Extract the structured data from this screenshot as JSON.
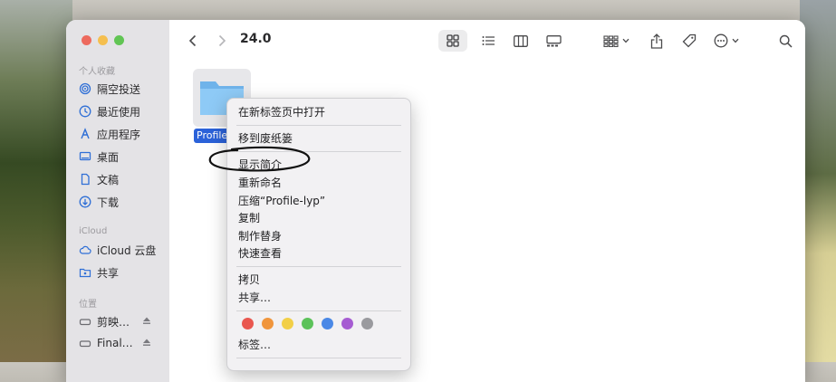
{
  "window": {
    "title": "24.0"
  },
  "sidebar": {
    "sections": [
      {
        "title": "个人收藏",
        "items": [
          {
            "label": "隔空投送",
            "icon": "airdrop-icon"
          },
          {
            "label": "最近使用",
            "icon": "clock-icon"
          },
          {
            "label": "应用程序",
            "icon": "applications-icon"
          },
          {
            "label": "桌面",
            "icon": "desktop-icon"
          },
          {
            "label": "文稿",
            "icon": "document-icon"
          },
          {
            "label": "下载",
            "icon": "download-icon"
          }
        ]
      },
      {
        "title": "iCloud",
        "items": [
          {
            "label": "iCloud 云盘",
            "icon": "cloud-icon"
          },
          {
            "label": "共享",
            "icon": "shared-folder-icon"
          }
        ]
      },
      {
        "title": "位置",
        "items": [
          {
            "label": "剪映…",
            "icon": "drive-icon"
          },
          {
            "label": "Final…",
            "icon": "drive-icon"
          }
        ]
      }
    ]
  },
  "content": {
    "folder": {
      "name": "Profile"
    }
  },
  "context_menu": {
    "items": [
      "在新标签页中打开",
      "移到废纸篓",
      "显示简介",
      "重新命名",
      "压缩“Profile-lyp”",
      "复制",
      "制作替身",
      "快速查看",
      "拷贝",
      "共享…",
      "标签…"
    ],
    "tag_colors": [
      "#e9574f",
      "#f0953c",
      "#f2cf47",
      "#5cc25a",
      "#4a88e6",
      "#a65cd2",
      "#9a9a9e"
    ]
  },
  "colors": {
    "accent": "#2b62d9",
    "annotation_ink": "#111111"
  }
}
